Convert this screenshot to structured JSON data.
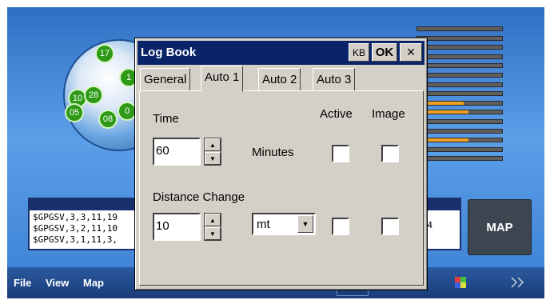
{
  "background": {
    "satellites": [
      "17",
      "1",
      "10",
      "28",
      "05",
      "08",
      "0"
    ],
    "signal_levels": [
      0,
      0,
      0,
      0,
      0,
      0,
      0,
      0.1,
      0.55,
      0.6,
      0,
      0,
      0.6,
      0.1,
      0
    ],
    "nmea_lines": [
      "$GPGSV,3,3,11,19",
      "$GPGSV,3,2,11,10",
      "$GPGSV,3,1,11,3,"
    ],
    "nmea_tail": "74",
    "map_button_label": "MAP"
  },
  "toolbar": {
    "menu": [
      "File",
      "View",
      "Map"
    ],
    "tool_icons": [
      "satellite-icon",
      "back-arrow-icon",
      "forward-arrow-icon",
      "folder-icon",
      "globe-pin-icon",
      "grid-icon",
      "color-grid-icon",
      "chevron-right-icon"
    ]
  },
  "dialog": {
    "title": "Log Book",
    "kb_label": "KB",
    "ok_label": "OK",
    "close_label": "×",
    "tabs": [
      {
        "label": "General",
        "active": false
      },
      {
        "label": "Auto 1",
        "active": true
      },
      {
        "label": "Auto 2",
        "active": false
      },
      {
        "label": "Auto 3",
        "active": false
      }
    ],
    "active_header": "Active",
    "image_header": "Image",
    "time": {
      "label": "Time",
      "value": "60",
      "unit": "Minutes",
      "active": false,
      "image": false
    },
    "distance": {
      "label": "Distance Change",
      "value": "10",
      "unit": "mt",
      "active": false,
      "image": false
    }
  }
}
